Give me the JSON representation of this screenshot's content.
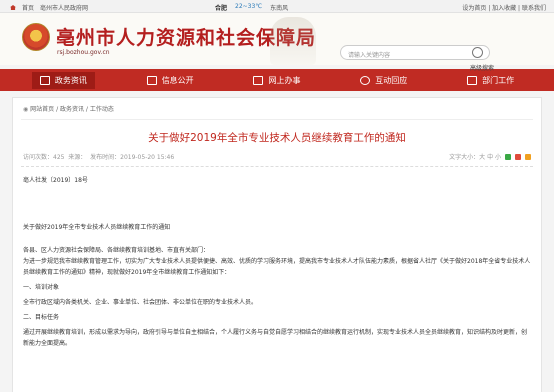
{
  "topbar": {
    "home": "首页",
    "site": "亳州市人民政府网",
    "city": "合肥",
    "temp": "22~33℃",
    "wind": "东南风",
    "right_links": "设为首页 | 加入收藏 | 联系我们"
  },
  "header": {
    "title": "亳州市人力资源和社会保障局",
    "domain": "rsj.bozhou.gov.cn",
    "search_placeholder": "请输入关键内容",
    "advanced": "高级搜索"
  },
  "nav": [
    {
      "label": "政务资讯",
      "active": true
    },
    {
      "label": "信息公开",
      "active": false
    },
    {
      "label": "网上办事",
      "active": false
    },
    {
      "label": "互动回应",
      "active": false
    },
    {
      "label": "部门工作",
      "active": false
    }
  ],
  "breadcrumb": "网站首页 / 政务资讯 / 工作动态",
  "article": {
    "title": "关于做好2019年全市专业技术人员继续教育工作的通知",
    "visits": "访问次数：425",
    "source": "来源：",
    "date": "发布时间：2019-05-20 15:46",
    "font_size": "文字大小：大 中 小",
    "doc_no": "亳人社发〔2019〕18号",
    "doc_title": "关于做好2019年全市专业技术人员继续教育工作的通知",
    "to": "各县、区人力资源社会保障局、各继续教育培训基地、市直有关部门：",
    "p1": "为进一步规范我市继续教育管理工作，切实为广大专业技术人员提供便捷、高效、优质的学习服务环境，提高我市专业技术人才队伍能力素质，根据省人社厅《关于做好2018年全省专业技术人员继续教育工作的通知》精神，现就做好2019年全市继续教育工作通知如下：",
    "h1": "一、培训对象",
    "p2": "全市行政区域内各类机关、企业、事业单位、社会团体、非公单位在职的专业技术人员。",
    "h2": "二、目标任务",
    "p3": "通过开展继续教育培训，形成以需求为导向，政府引导与单位自主相结合，个人履行义务与自觉自愿学习相结合的继续教育运行机制，实现专业技术人员全员继续教育，知识结构及时更新，创新能力全面提高。"
  },
  "colors": {
    "brand_red": "#c02b23",
    "title_red": "#b41f1f"
  }
}
